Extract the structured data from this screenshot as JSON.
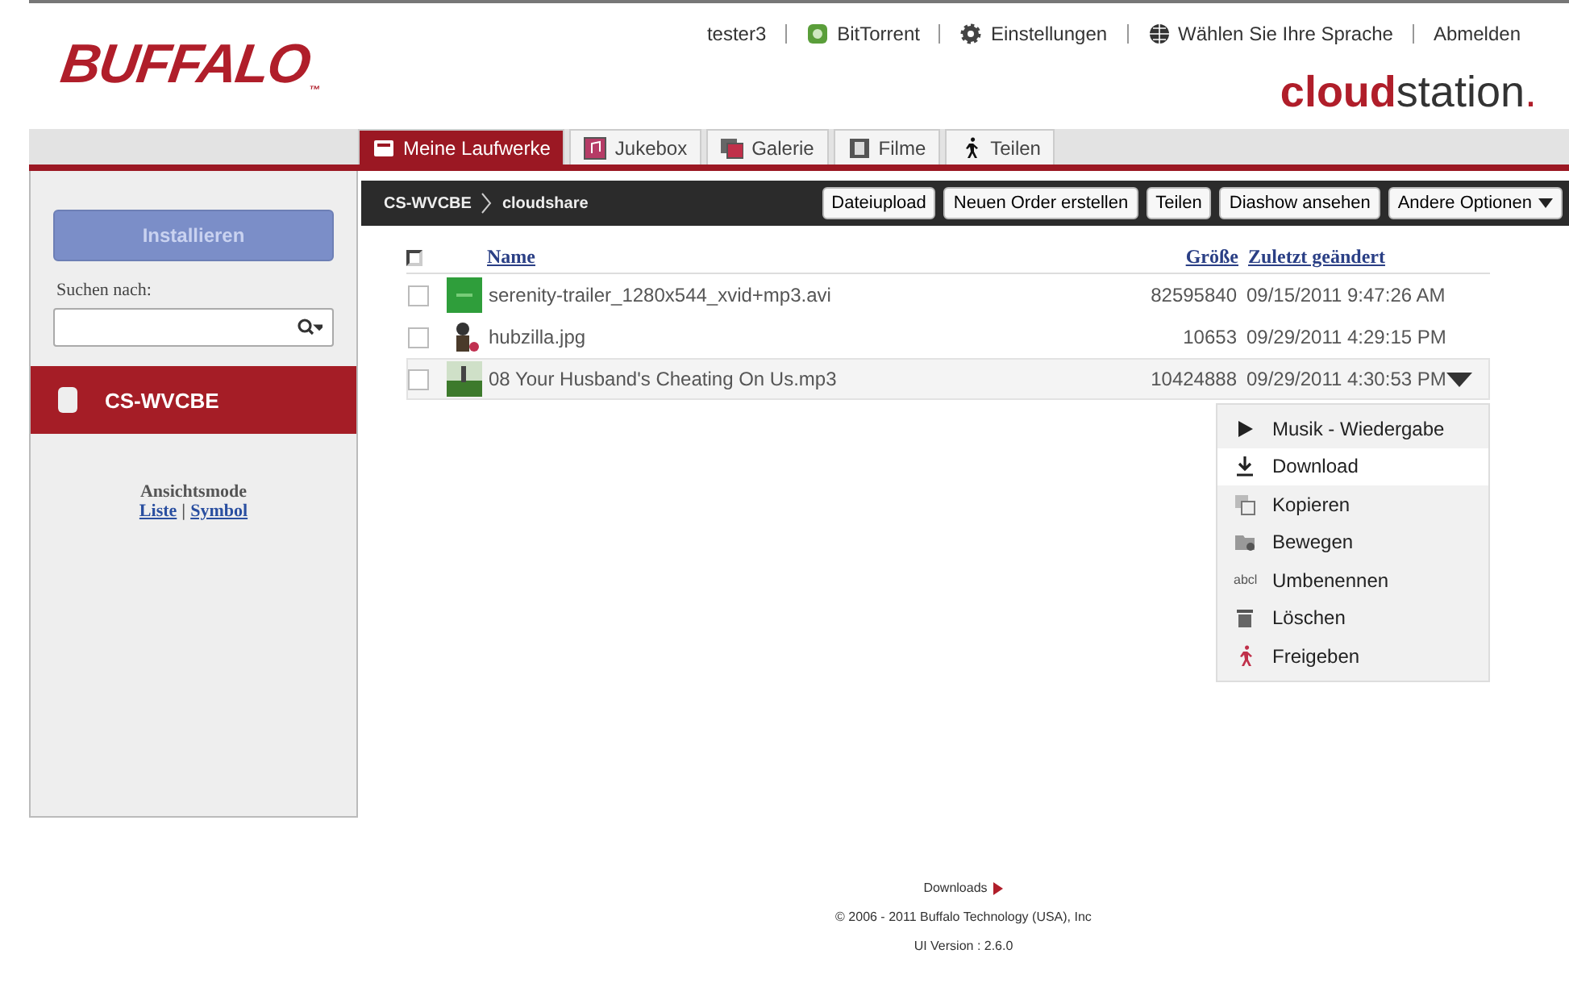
{
  "header": {
    "logo": "BUFFALO",
    "logo_mark": "™",
    "user": "tester3",
    "links": [
      {
        "kind": "torrent",
        "label": "BitTorrent"
      },
      {
        "kind": "gear",
        "label": "Einstellungen"
      },
      {
        "kind": "globe",
        "label": "Wählen Sie Ihre Sprache"
      },
      {
        "kind": "plain",
        "label": "Abmelden"
      }
    ],
    "brand_bold": "cloud",
    "brand_light": "station",
    "brand_suffix": "."
  },
  "tabs": [
    {
      "kind": "drive",
      "label": "Meine Laufwerke",
      "selected": true
    },
    {
      "kind": "music",
      "label": "Jukebox",
      "selected": false
    },
    {
      "kind": "gallery",
      "label": "Galerie",
      "selected": false
    },
    {
      "kind": "film",
      "label": "Filme",
      "selected": false
    },
    {
      "kind": "walker",
      "label": "Teilen",
      "selected": false
    }
  ],
  "sidebar": {
    "install_button": "Installieren",
    "search_label": "Suchen nach:",
    "drives": [
      {
        "label": "CS-WVCBE",
        "selected": true
      }
    ],
    "view_mode_label": "Ansichtsmode",
    "view_links": [
      {
        "label": "Liste"
      },
      {
        "label": "Symbol"
      }
    ],
    "view_separator": "|"
  },
  "breadcrumb": [
    "CS-WVCBE",
    "cloudshare"
  ],
  "toolbar": [
    "Dateiupload",
    "Neuen Order erstellen",
    "Teilen",
    "Diashow ansehen",
    "Andere Optionen"
  ],
  "table": {
    "columns": [
      "Name",
      "Größe",
      "Zuletzt geändert"
    ],
    "select_all_checked": false,
    "rows": [
      {
        "kind": "video",
        "name": "serenity-trailer_1280x544_xvid+mp3.avi",
        "size": "82595840",
        "modified": "09/15/2011 9:47:26 AM",
        "checked": false,
        "hovered": false
      },
      {
        "name": "hubzilla.jpg",
        "size": "10653",
        "modified": "09/29/2011 4:29:15 PM",
        "checked": false,
        "hovered": false
      },
      {
        "kind": "audio",
        "name": "08 Your Husband's Cheating On Us.mp3",
        "size": "10424888",
        "modified": "09/29/2011 4:30:53 PM",
        "checked": false,
        "hovered": true
      }
    ]
  },
  "context_menu": [
    {
      "kind": "play",
      "label": "Musik - Wiedergabe",
      "selected": false
    },
    {
      "kind": "download",
      "label": "Download",
      "selected": true
    },
    {
      "kind": "copy",
      "label": "Kopieren",
      "selected": false
    },
    {
      "kind": "move",
      "label": "Bewegen",
      "selected": false
    },
    {
      "kind": "text",
      "icon_text": "abcl",
      "label": "Umbenennen",
      "selected": false
    },
    {
      "kind": "trash",
      "label": "Löschen",
      "selected": false
    },
    {
      "kind": "walker",
      "label": "Freigeben",
      "selected": false
    }
  ],
  "footer": {
    "downloads_link": "Downloads",
    "copyright": "© 2006 - 2011 Buffalo Technology (USA), Inc",
    "version": "UI Version : 2.6.0"
  }
}
